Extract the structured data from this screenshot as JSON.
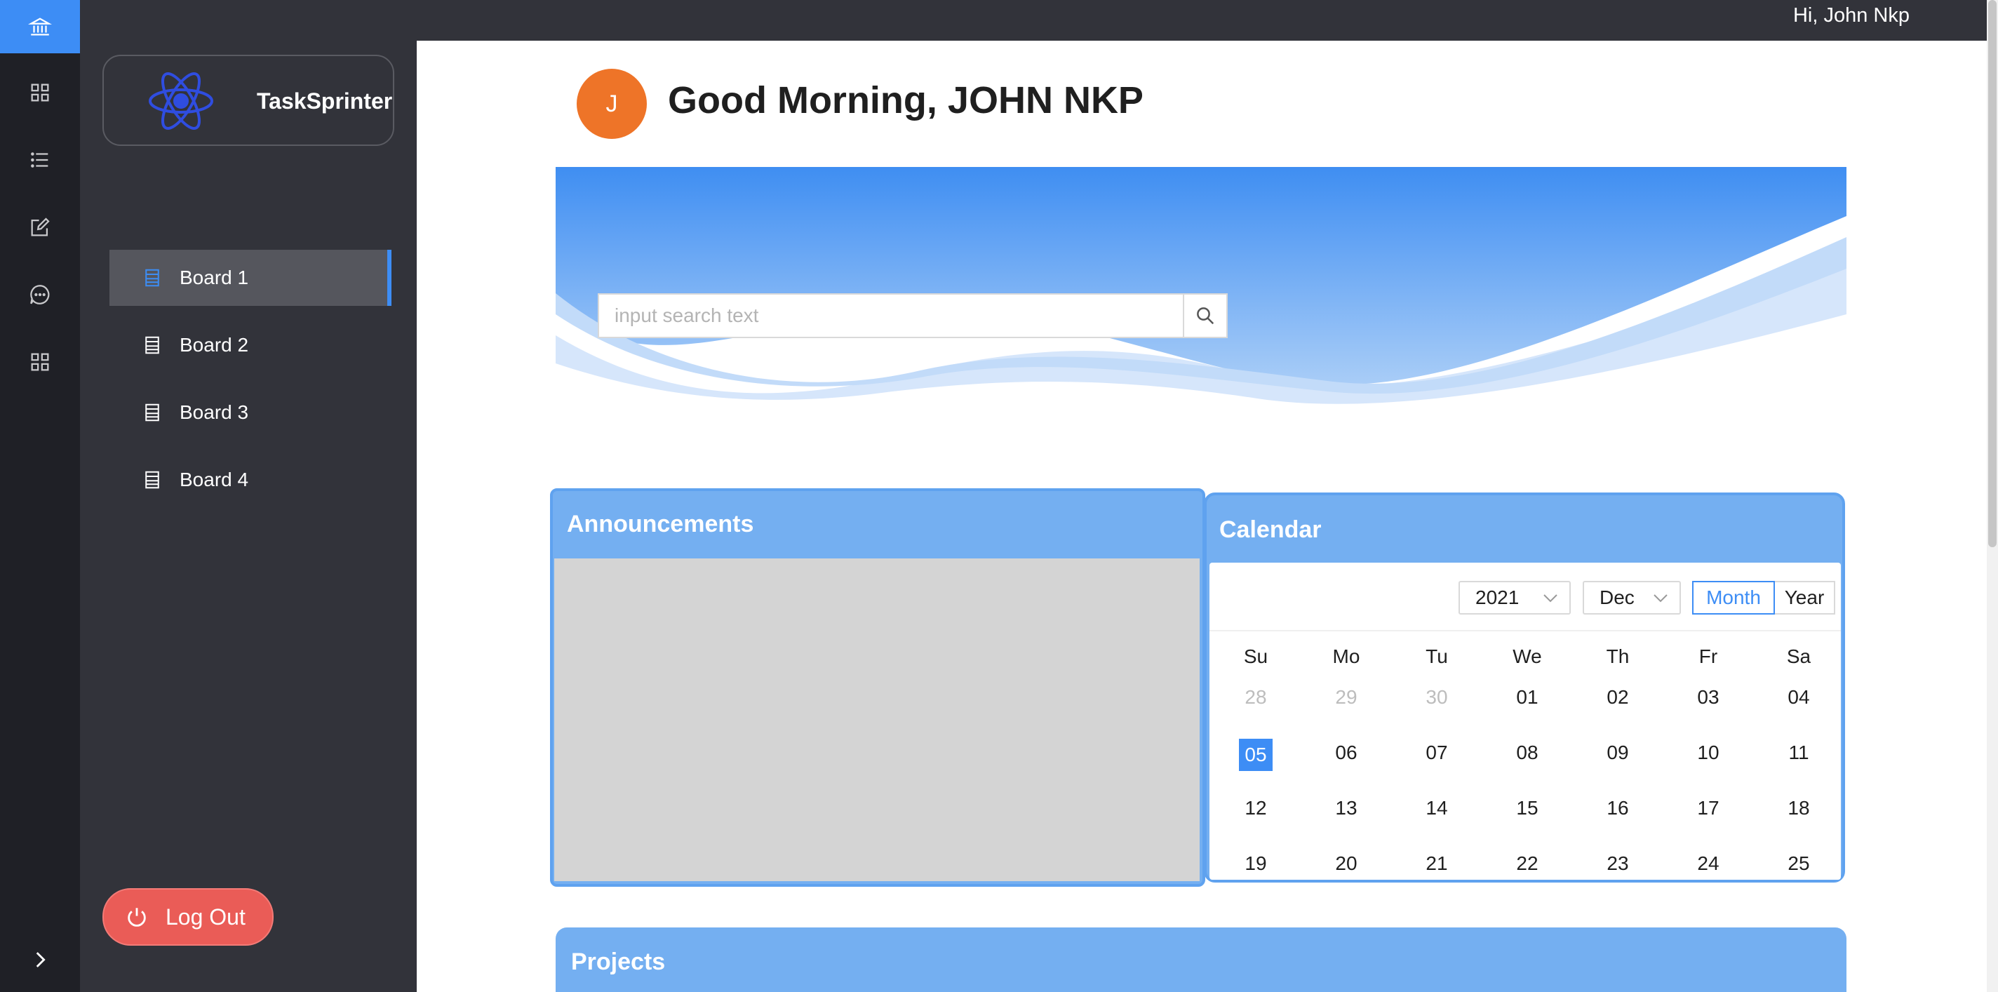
{
  "app": {
    "name": "TaskSprinter"
  },
  "topbar": {
    "greeting": "Hi, John Nkp"
  },
  "sidebar": {
    "boards": [
      {
        "label": "Board 1",
        "active": true
      },
      {
        "label": "Board 2",
        "active": false
      },
      {
        "label": "Board 3",
        "active": false
      },
      {
        "label": "Board 4",
        "active": false
      }
    ],
    "logout_label": "Log Out"
  },
  "rail": {
    "icons": [
      "bank-icon",
      "grid-icon",
      "list-icon",
      "edit-icon",
      "chat-icon",
      "apps-icon",
      "chevron-right-icon"
    ],
    "active_color": "#3d8df5"
  },
  "header": {
    "avatar_initial": "J",
    "title": "Good Morning, JOHN NKP"
  },
  "search": {
    "placeholder": "input search text"
  },
  "announcements": {
    "title": "Announcements"
  },
  "calendar": {
    "title": "Calendar",
    "year": "2021",
    "month": "Dec",
    "mode_month": "Month",
    "mode_year": "Year",
    "weekdays": [
      "Su",
      "Mo",
      "Tu",
      "We",
      "Th",
      "Fr",
      "Sa"
    ],
    "weeks": [
      [
        "28",
        "29",
        "30",
        "01",
        "02",
        "03",
        "04"
      ],
      [
        "05",
        "06",
        "07",
        "08",
        "09",
        "10",
        "11"
      ],
      [
        "12",
        "13",
        "14",
        "15",
        "16",
        "17",
        "18"
      ],
      [
        "19",
        "20",
        "21",
        "22",
        "23",
        "24",
        "25"
      ]
    ],
    "muted_days": [
      "28",
      "29",
      "30"
    ],
    "selected_day": "05"
  },
  "projects": {
    "title": "Projects"
  },
  "colors": {
    "accent": "#3d8df5",
    "panel_blue": "#74aff1",
    "logout_red": "#ea5c57",
    "avatar_orange": "#ee7428",
    "sidebar_dark": "#32333a"
  }
}
